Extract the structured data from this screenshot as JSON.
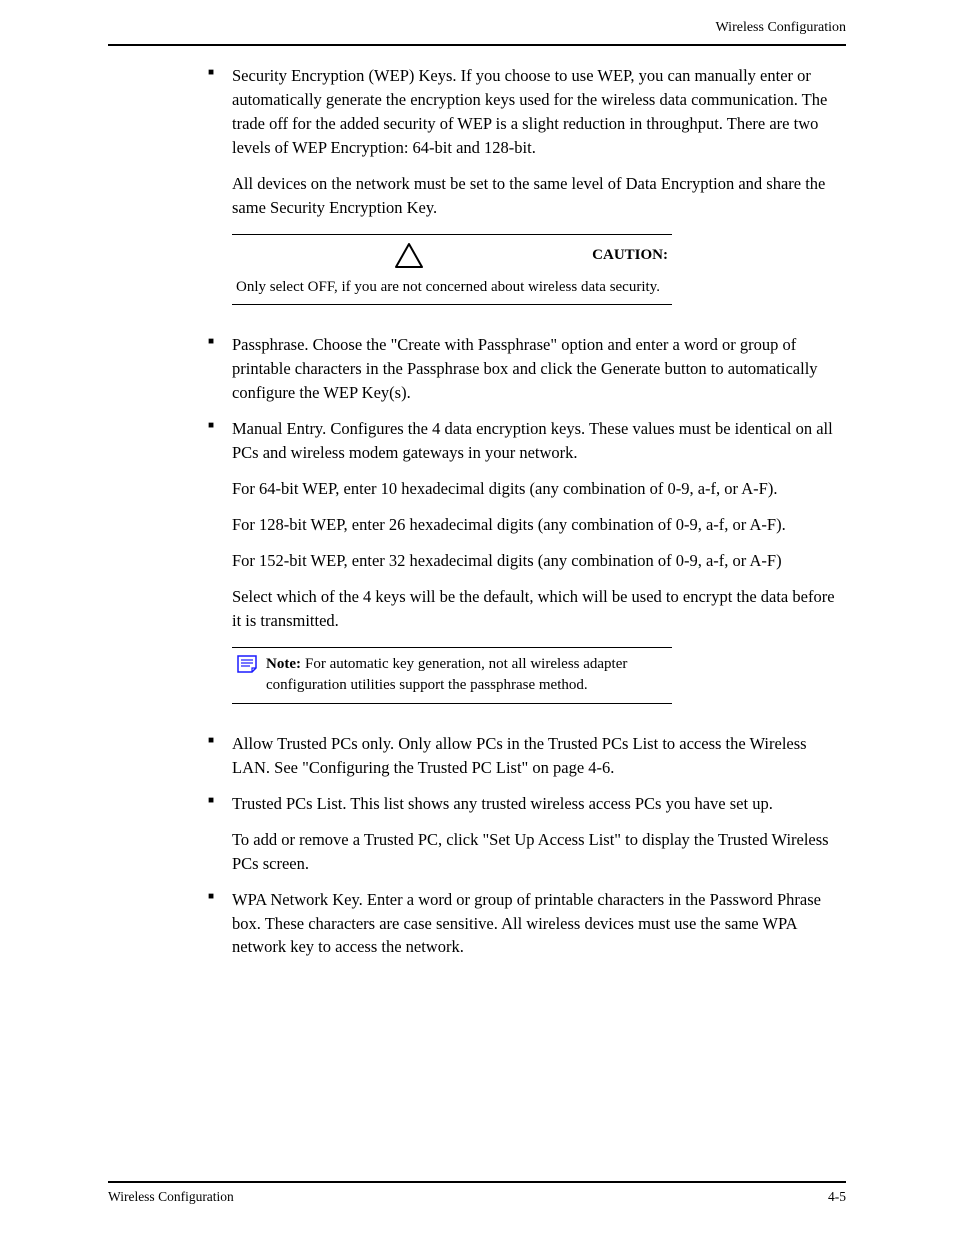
{
  "runningHead": "Wireless Configuration",
  "bullets": {
    "b1a": "Security Encryption (WEP) Keys. If you choose to use WEP, you can manually enter or automatically generate the encryption keys used for the wireless data communication. The trade off for the added security of WEP is a slight reduction in throughput. There are two levels of WEP Encryption: 64-bit and 128-bit.",
    "b1b": "All devices on the network must be set to the same level of Data Encryption and share the same Security Encryption Key.",
    "caution": {
      "label": "CAUTION:",
      "body": "Only select OFF, if you are not concerned about wireless data security."
    },
    "b2": "Passphrase. Choose the \"Create with Passphrase\" option and enter a word or group of printable characters in the Passphrase box and click the Generate button to automatically configure the WEP Key(s).",
    "b3a": "Manual Entry. Configures the 4 data encryption keys. These values must be identical on all PCs and wireless modem gateways in your network.",
    "b3b": "For 64-bit WEP, enter 10 hexadecimal digits (any combination of 0-9, a-f, or A-F).",
    "b3c": "For 128-bit WEP, enter 26 hexadecimal digits (any combination of 0-9, a-f, or A-F).",
    "b3d": "For 152-bit WEP, enter 32 hexadecimal digits (any combination of 0-9, a-f, or A-F)",
    "b3e": "Select which of the 4 keys will be the default, which will be used to encrypt the data before it is transmitted.",
    "note": {
      "label": "Note:",
      "body": "For automatic key generation, not all wireless adapter configuration utilities support the passphrase method."
    },
    "b4": "Allow Trusted PCs only. Only allow PCs in the Trusted PCs List to access the Wireless LAN. See \"Configuring the Trusted PC List\" on page 4-6.",
    "b5a": "Trusted PCs List. This list shows any trusted wireless access PCs you have set up.",
    "b5b": "To add or remove a Trusted PC, click \"Set Up Access List\" to display the Trusted Wireless PCs screen.",
    "b6": "WPA Network Key. Enter a word or group of printable characters in the Password Phrase box. These characters are case sensitive. All wireless devices must use the same WPA network key to access the network."
  },
  "footer": {
    "left": "Wireless Configuration",
    "right": "4-5"
  }
}
